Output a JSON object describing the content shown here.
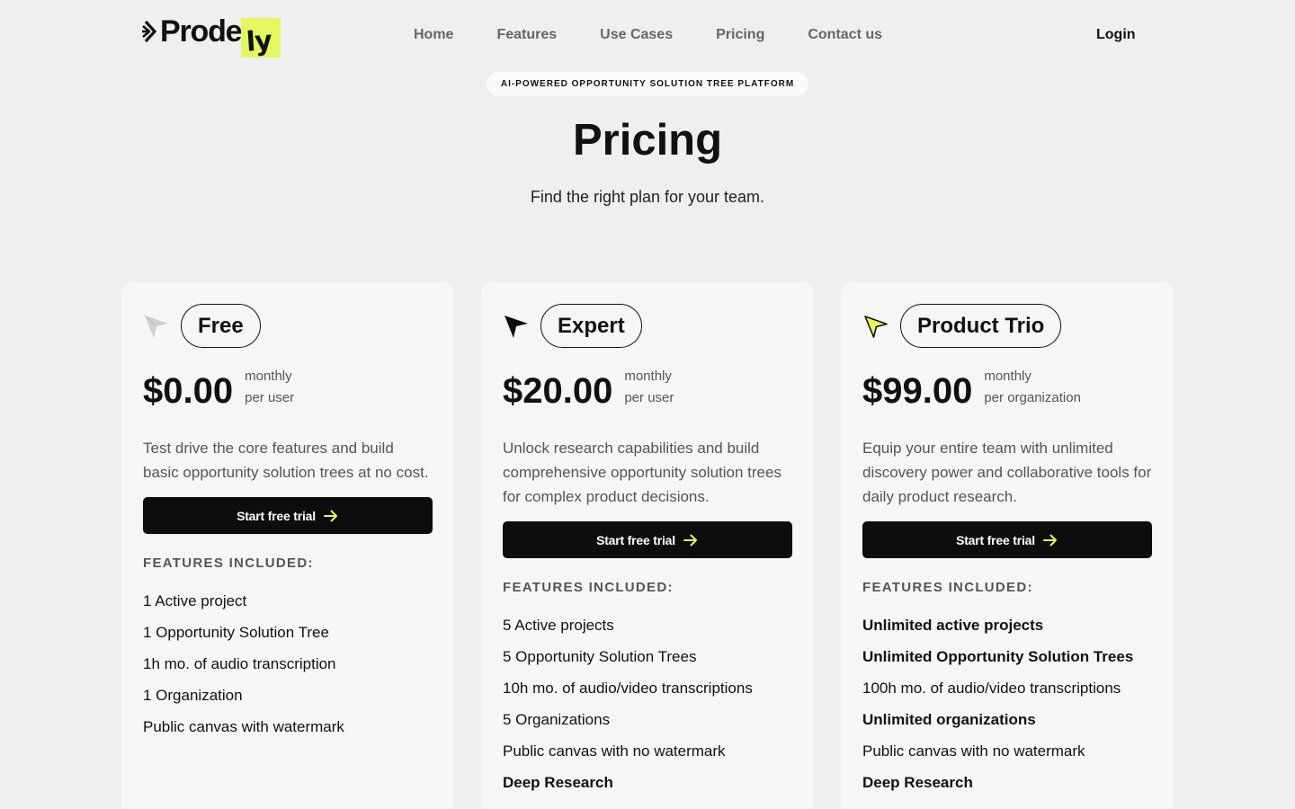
{
  "header": {
    "logo_main": "Prode",
    "logo_highlight": "ly",
    "nav": [
      "Home",
      "Features",
      "Use Cases",
      "Pricing",
      "Contact us"
    ],
    "login": "Login"
  },
  "hero": {
    "badge": "AI-POWERED OPPORTUNITY SOLUTION TREE PLATFORM",
    "title": "Pricing",
    "subtitle": "Find the right plan for your team."
  },
  "colors": {
    "accent": "#e2f760",
    "dark": "#0d0d0d",
    "background": "#efefef",
    "card": "#f6f6f6"
  },
  "plans": [
    {
      "name": "Free",
      "icon": "cursor-arrow-gray-icon",
      "price": "$0.00",
      "period": "monthly",
      "unit": "per user",
      "description": "Test drive the core features and build basic opportunity solution trees at no cost.",
      "cta": "Start free trial",
      "features_heading": "FEATURES INCLUDED:",
      "features": [
        {
          "text": "1 Active project",
          "bold": false
        },
        {
          "text": "1 Opportunity Solution Tree",
          "bold": false
        },
        {
          "text": "1h mo. of audio transcription",
          "bold": false
        },
        {
          "text": "1 Organization",
          "bold": false
        },
        {
          "text": "Public canvas with watermark",
          "bold": false
        }
      ]
    },
    {
      "name": "Expert",
      "icon": "cursor-arrow-black-icon",
      "price": "$20.00",
      "period": "monthly",
      "unit": "per user",
      "description": "Unlock research capabilities and build comprehensive opportunity solution trees for complex product decisions.",
      "cta": "Start free trial",
      "features_heading": "FEATURES INCLUDED:",
      "features": [
        {
          "text": "5 Active projects",
          "bold": false
        },
        {
          "text": "5 Opportunity Solution Trees",
          "bold": false
        },
        {
          "text": "10h mo. of audio/video transcriptions",
          "bold": false
        },
        {
          "text": "5 Organizations",
          "bold": false
        },
        {
          "text": "Public canvas with no watermark",
          "bold": false
        },
        {
          "text": "Deep Research",
          "bold": true
        }
      ]
    },
    {
      "name": "Product Trio",
      "icon": "cursor-arrow-lime-icon",
      "price": "$99.00",
      "period": "monthly",
      "unit": "per organization",
      "description": "Equip your entire team with unlimited discovery power and collaborative tools for daily product research.",
      "cta": "Start free trial",
      "features_heading": "FEATURES INCLUDED:",
      "features": [
        {
          "text": "Unlimited active projects",
          "bold": true
        },
        {
          "text": "Unlimited Opportunity Solution Trees",
          "bold": true
        },
        {
          "text": "100h mo. of audio/video transcriptions",
          "bold": false
        },
        {
          "text": "Unlimited organizations",
          "bold": true
        },
        {
          "text": "Public canvas with no watermark",
          "bold": false
        },
        {
          "text": "Deep Research",
          "bold": true
        }
      ]
    }
  ]
}
